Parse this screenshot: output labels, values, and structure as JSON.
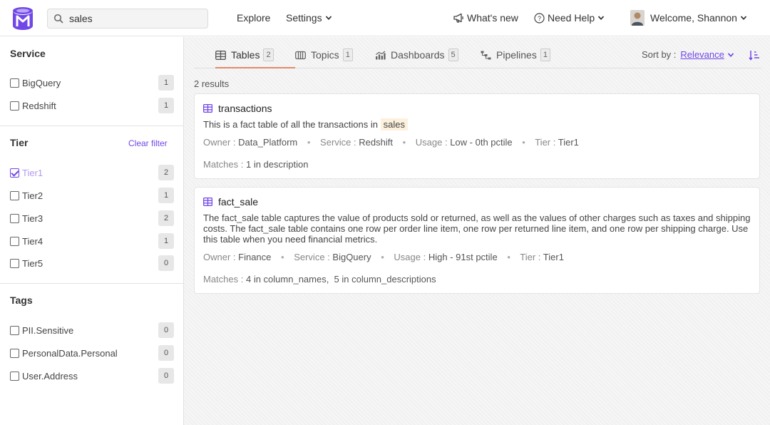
{
  "header": {
    "search_value": "sales",
    "nav": {
      "explore": "Explore",
      "settings": "Settings",
      "whats_new": "What's new",
      "need_help": "Need Help",
      "welcome": "Welcome, Shannon"
    }
  },
  "sidebar": {
    "service": {
      "title": "Service",
      "items": [
        {
          "label": "BigQuery",
          "count": "1",
          "checked": false
        },
        {
          "label": "Redshift",
          "count": "1",
          "checked": false
        }
      ]
    },
    "tier": {
      "title": "Tier",
      "clear_label": "Clear filter",
      "items": [
        {
          "label": "Tier1",
          "count": "2",
          "checked": true
        },
        {
          "label": "Tier2",
          "count": "1",
          "checked": false
        },
        {
          "label": "Tier3",
          "count": "2",
          "checked": false
        },
        {
          "label": "Tier4",
          "count": "1",
          "checked": false
        },
        {
          "label": "Tier5",
          "count": "0",
          "checked": false
        }
      ]
    },
    "tags": {
      "title": "Tags",
      "items": [
        {
          "label": "PII.Sensitive",
          "count": "0",
          "checked": false
        },
        {
          "label": "PersonalData.Personal",
          "count": "0",
          "checked": false
        },
        {
          "label": "User.Address",
          "count": "0",
          "checked": false
        }
      ]
    }
  },
  "tabs": [
    {
      "label": "Tables",
      "count": "2",
      "icon": "table-icon",
      "active": true
    },
    {
      "label": "Topics",
      "count": "1",
      "icon": "topic-icon",
      "active": false
    },
    {
      "label": "Dashboards",
      "count": "5",
      "icon": "dashboard-icon",
      "active": false
    },
    {
      "label": "Pipelines",
      "count": "1",
      "icon": "pipeline-icon",
      "active": false
    }
  ],
  "sort": {
    "label": "Sort by :",
    "value": "Relevance"
  },
  "results_count": "2 results",
  "results": [
    {
      "title": "transactions",
      "desc_pre": "This is a fact table of all the transactions in",
      "desc_hl": "sales",
      "owner_k": "Owner :",
      "owner": "Data_Platform",
      "service_k": "Service :",
      "service": "Redshift",
      "usage_k": "Usage :",
      "usage": "Low - 0th pctile",
      "tier_k": "Tier :",
      "tier": "Tier1",
      "matches_k": "Matches :",
      "matches": "1 in description"
    },
    {
      "title": "fact_sale",
      "desc": "The fact_sale table captures the value of products sold or returned, as well as the values of other charges such as taxes and shipping costs. The fact_sale table contains one row per order line item, one row per returned line item, and one row per shipping charge. Use this table when you need financial metrics.",
      "owner_k": "Owner :",
      "owner": "Finance",
      "service_k": "Service :",
      "service": "BigQuery",
      "usage_k": "Usage :",
      "usage": "High - 91st pctile",
      "tier_k": "Tier :",
      "tier": "Tier1",
      "matches_k": "Matches :",
      "matches": "4 in column_names,  5 in column_descriptions"
    }
  ],
  "colors": {
    "accent": "#7147e8",
    "tab_underline": "#e08b6a",
    "highlight": "#fdf1dd"
  }
}
